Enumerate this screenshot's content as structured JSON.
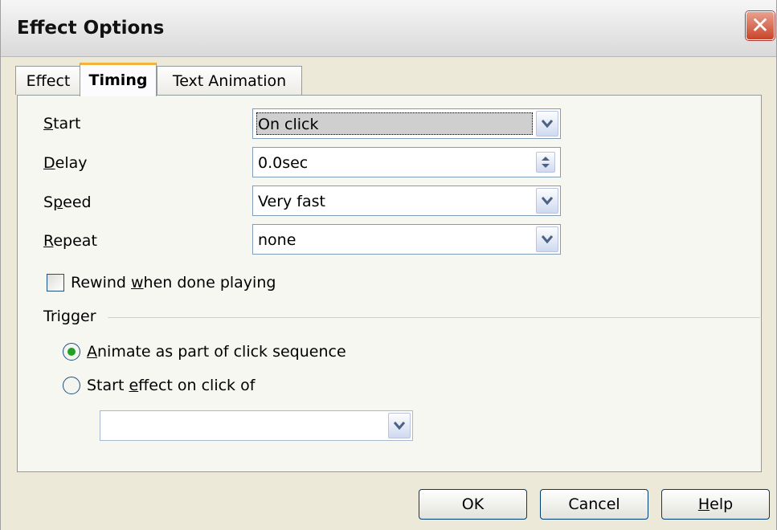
{
  "window": {
    "title": "Effect Options",
    "close_icon": "close-icon"
  },
  "tabs": [
    {
      "label": "Effect",
      "active": false
    },
    {
      "label": "Timing",
      "active": true
    },
    {
      "label": "Text Animation",
      "active": false
    }
  ],
  "timing": {
    "start": {
      "label_u": "S",
      "label_rest": "tart",
      "value": "On click"
    },
    "delay": {
      "label_u": "D",
      "label_rest": "elay",
      "value": "0.0sec"
    },
    "speed": {
      "label_pre": "S",
      "label_u": "p",
      "label_rest": "eed",
      "value": "Very fast"
    },
    "repeat": {
      "label_u": "R",
      "label_rest": "epeat",
      "value": "none"
    },
    "rewind": {
      "label_pre": "Rewind ",
      "label_u": "w",
      "label_rest": "hen done playing",
      "checked": false
    }
  },
  "trigger": {
    "label": "Trigger",
    "option1": {
      "label_u": "A",
      "label_rest": "nimate as part of click sequence",
      "selected": true
    },
    "option2": {
      "label_pre": "Start ",
      "label_u": "e",
      "label_rest": "ffect on click of",
      "selected": false
    },
    "shape_value": ""
  },
  "buttons": {
    "ok": "OK",
    "cancel": "Cancel",
    "help_u": "H",
    "help_rest": "elp"
  }
}
